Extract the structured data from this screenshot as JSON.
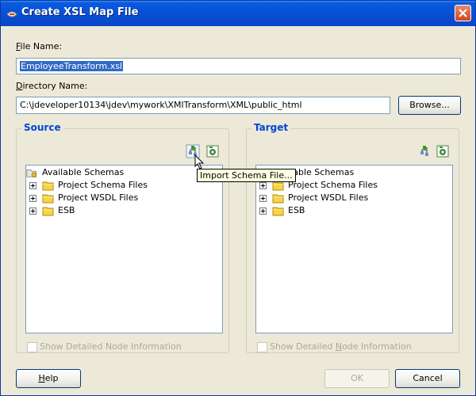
{
  "window": {
    "title": "Create XSL Map File"
  },
  "file_name": {
    "label_u": "F",
    "label_rest": "ile Name:",
    "value": "EmployeeTransform.xsl"
  },
  "directory": {
    "label_u": "D",
    "label_rest": "irectory Name:",
    "value": "C:\\jdeveloper10134\\jdev\\mywork\\XMlTransform\\XML\\public_html"
  },
  "browse_label": "Browse...",
  "source": {
    "title": "Source",
    "root": "Available Schemas",
    "items": [
      "Project Schema Files",
      "Project WSDL Files",
      "ESB"
    ],
    "checkbox": "Show Detailed Node Information"
  },
  "target": {
    "title": "Target",
    "root": "Available Schemas",
    "items": [
      "Project Schema Files",
      "Project WSDL Files",
      "ESB"
    ],
    "checkbox_u": "N",
    "checkbox_pre": "Show Detailed ",
    "checkbox_post": "ode Information"
  },
  "tooltip": "Import Schema File...",
  "buttons": {
    "help_u": "H",
    "help_rest": "elp",
    "ok": "OK",
    "cancel": "Cancel"
  }
}
